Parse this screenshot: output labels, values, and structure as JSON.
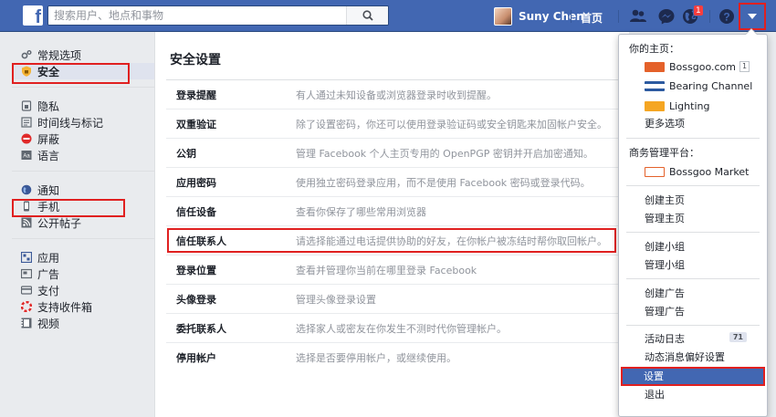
{
  "topbar": {
    "logo": "f",
    "search_placeholder": "搜索用户、地点和事物",
    "search_icon": "search-icon",
    "user_name": "Suny Chen",
    "home_label": "首页",
    "notifications_badge": "1",
    "icons": [
      "friend-requests-icon",
      "messenger-icon",
      "globe-notifications-icon",
      "help-icon",
      "dropdown-caret-icon"
    ],
    "brand_color": "#4267b2"
  },
  "sidebar": {
    "groups": [
      {
        "items": [
          {
            "label": "常规选项",
            "icon": "gear-icon"
          },
          {
            "label": "安全",
            "icon": "shield-icon",
            "active": true
          }
        ]
      },
      {
        "items": [
          {
            "label": "隐私",
            "icon": "lock-icon"
          },
          {
            "label": "时间线与标记",
            "icon": "timeline-icon"
          },
          {
            "label": "屏蔽",
            "icon": "block-icon"
          },
          {
            "label": "语言",
            "icon": "language-icon"
          }
        ]
      },
      {
        "items": [
          {
            "label": "通知",
            "icon": "globe-icon"
          },
          {
            "label": "手机",
            "icon": "mobile-icon"
          },
          {
            "label": "公开帖子",
            "icon": "rss-icon"
          }
        ]
      },
      {
        "items": [
          {
            "label": "应用",
            "icon": "apps-icon"
          },
          {
            "label": "广告",
            "icon": "ads-icon"
          },
          {
            "label": "支付",
            "icon": "payments-icon"
          },
          {
            "label": "支持收件箱",
            "icon": "support-icon"
          },
          {
            "label": "视频",
            "icon": "video-icon"
          }
        ]
      }
    ]
  },
  "main": {
    "title": "安全设置",
    "rows": [
      {
        "name": "登录提醒",
        "desc": "有人通过未知设备或浏览器登录时收到提醒。"
      },
      {
        "name": "双重验证",
        "desc": "除了设置密码，你还可以使用登录验证码或安全钥匙来加固帐户安全。"
      },
      {
        "name": "公钥",
        "desc": "管理 Facebook 个人主页专用的 OpenPGP 密钥并开启加密通知。"
      },
      {
        "name": "应用密码",
        "desc": "使用独立密码登录应用，而不是使用 Facebook 密码或登录代码。"
      },
      {
        "name": "信任设备",
        "desc": "查看你保存了哪些常用浏览器"
      },
      {
        "name": "信任联系人",
        "desc": "请选择能通过电话提供协助的好友，在你帐户被冻结时帮你取回帐户。",
        "highlighted": true
      },
      {
        "name": "登录位置",
        "desc": "查看并管理你当前在哪里登录 Facebook"
      },
      {
        "name": "头像登录",
        "desc": "管理头像登录设置"
      },
      {
        "name": "委托联系人",
        "desc": "选择家人或密友在你发生不测时代你管理帐户。"
      },
      {
        "name": "停用帐户",
        "desc": "选择是否要停用帐户，或继续使用。"
      }
    ]
  },
  "menu": {
    "your_pages_header": "你的主页：",
    "pages": [
      {
        "name": "Bossgoo.com",
        "count": "1",
        "logo_color": "#e4612a"
      },
      {
        "name": "Bearing Channel",
        "logo_color": "#2c5aa0"
      },
      {
        "name": "Lighting",
        "logo_color": "#f5a623"
      }
    ],
    "more_options": "更多选项",
    "business_header": "商务管理平台：",
    "business_pages": [
      {
        "name": "Bossgoo Market",
        "logo_color": "#e4612a"
      }
    ],
    "items_group1": [
      "创建主页",
      "管理主页"
    ],
    "items_group2": [
      "创建小组",
      "管理小组"
    ],
    "items_group3": [
      "创建广告",
      "管理广告"
    ],
    "activity_log": "活动日志",
    "activity_count": "71",
    "news_feed_prefs": "动态消息偏好设置",
    "settings": "设置",
    "logout": "退出",
    "highlight_color": "#e02020"
  }
}
